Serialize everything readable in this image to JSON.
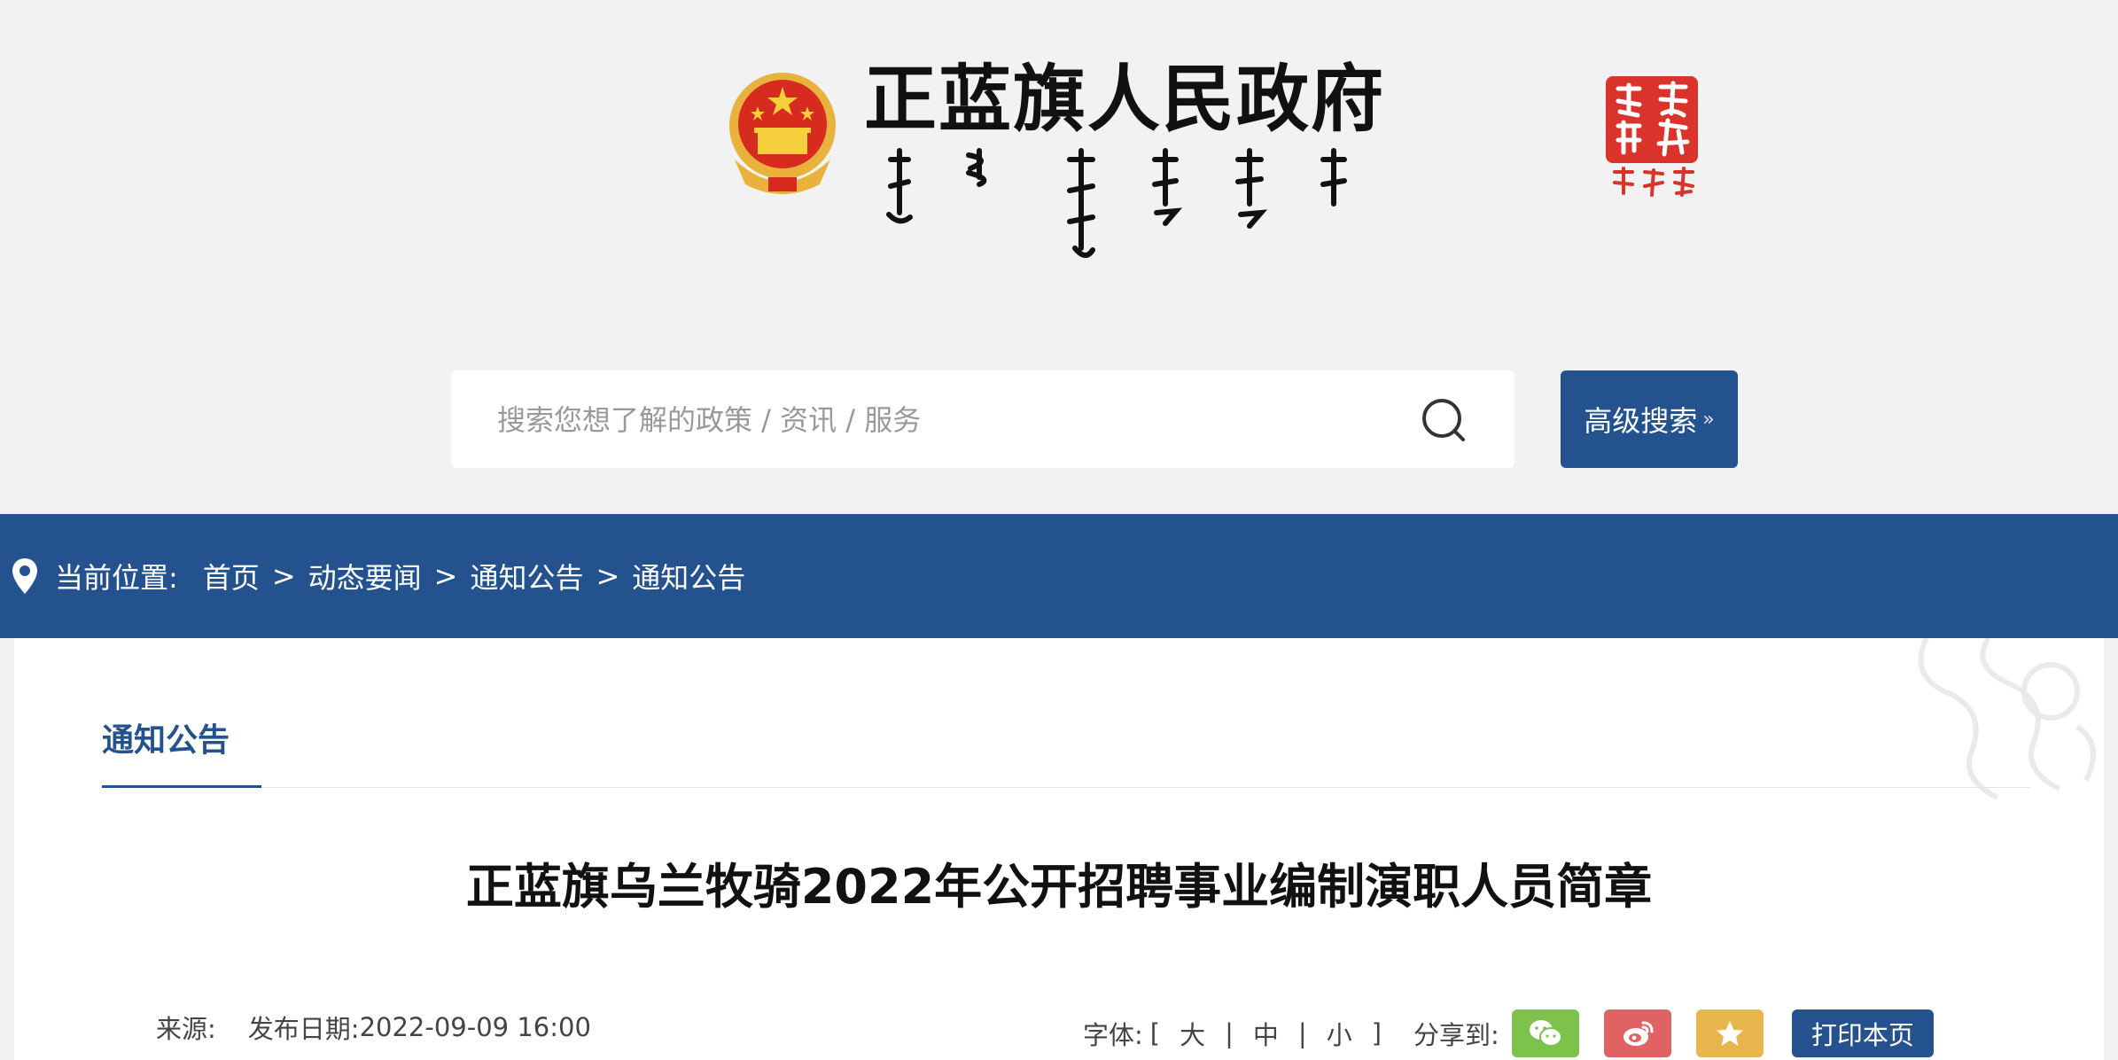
{
  "header": {
    "site_title": "正蓝旗人民政府"
  },
  "search": {
    "placeholder": "搜索您想了解的政策 / 资讯 / 服务",
    "advanced_label": "高级搜索"
  },
  "breadcrumb": {
    "label": "当前位置:",
    "items": [
      "首页",
      "动态要闻",
      "通知公告",
      "通知公告"
    ],
    "separator": ">"
  },
  "content": {
    "tab_label": "通知公告",
    "article_title": "正蓝旗乌兰牧骑2022年公开招聘事业编制演职人员简章",
    "source_label": "来源:",
    "date_label": "发布日期:",
    "date_value": "2022-09-09 16:00",
    "font_label": "字体:",
    "font_bracket_open": "[",
    "font_bracket_close": "]",
    "font_sizes": [
      "大",
      "中",
      "小"
    ],
    "font_separator": "|",
    "share_label": "分享到:",
    "print_label": "打印本页"
  },
  "colors": {
    "primary_blue": "#24528f",
    "wechat_green": "#7cc24b",
    "weibo_red": "#e06262",
    "favorite_yellow": "#e9b64e",
    "background": "#f2f2f2"
  },
  "icons": {
    "emblem": "national-emblem-icon",
    "search": "search-icon",
    "pin": "location-pin-icon",
    "wechat": "wechat-icon",
    "weibo": "weibo-icon",
    "favorite": "star-icon"
  }
}
